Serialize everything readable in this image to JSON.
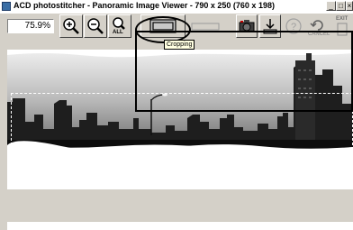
{
  "window": {
    "title": "ACD photostitcher - Panoramic Image Viewer - 790 x 250 (760 x 198)",
    "minimize_glyph": "_",
    "maximize_glyph": "□",
    "close_glyph": "×"
  },
  "toolbar": {
    "zoom_value": "75.9%",
    "zoom_in_icon": "zoom-in",
    "zoom_out_icon": "zoom-out",
    "zoom_all_label": "ALL",
    "cropping_icon": "cropping-frame",
    "save_icon": "save-download",
    "help_icon": "question-mark",
    "cancel_label": "CANCEL",
    "exit_label": "EXIT"
  },
  "tooltip": {
    "text": "Cropping"
  },
  "colors": {
    "window_bg": "#d4d0c8",
    "tooltip_bg": "#ffffe1",
    "viewer_bg": "#ffffff",
    "sky_top": "#e8e8e8",
    "sky_bottom": "#8a8a8a"
  }
}
